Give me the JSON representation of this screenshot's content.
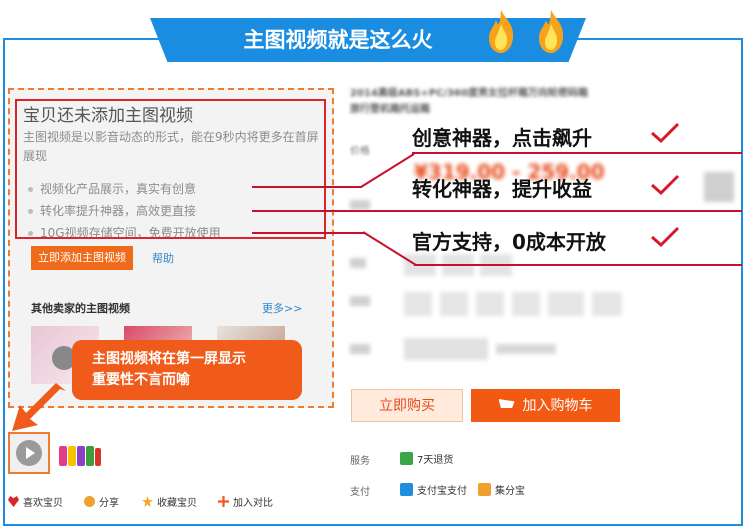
{
  "banner": {
    "title": "主图视频就是这么火"
  },
  "left_panel": {
    "heading": "宝贝还未添加主图视频",
    "description": "主图视频是以影音动态的形式，能在9秒内将更多在首屏展现",
    "bullets": [
      "视频化产品展示，真实有创意",
      "转化率提升神器，高效更直接",
      "10G视频存储空间，免费开放使用"
    ],
    "add_button": "立即添加主图视频",
    "help_link": "帮助",
    "others_title": "其他卖家的主图视频",
    "more_link": "更多>>"
  },
  "features": [
    "创意神器，点击飙升",
    "转化神器，提升收益",
    "官方支持，0成本开放"
  ],
  "callout": {
    "line1": "主图视频将在第一屏显示",
    "line2": "重要性不言而喻"
  },
  "product": {
    "title": "2014高级ABS+PC/360度男女拉杆箱万向轮密码箱旅行登机箱托运箱",
    "price": "¥319.00 - 259.00",
    "buy_now": "立即购买",
    "add_to_cart": "加入购物车"
  },
  "service": {
    "service_label": "服务",
    "service_item": "7天退货",
    "pay_label": "支付",
    "pay_items": [
      "支付宝支付",
      "集分宝"
    ]
  },
  "bottom_links": [
    "喜欢宝贝",
    "分享",
    "收藏宝贝",
    "加入对比"
  ],
  "colors": {
    "accent_blue": "#1b8de0",
    "orange": "#f05a1a",
    "red_line": "#c6102f",
    "check_red": "#d7192a"
  }
}
